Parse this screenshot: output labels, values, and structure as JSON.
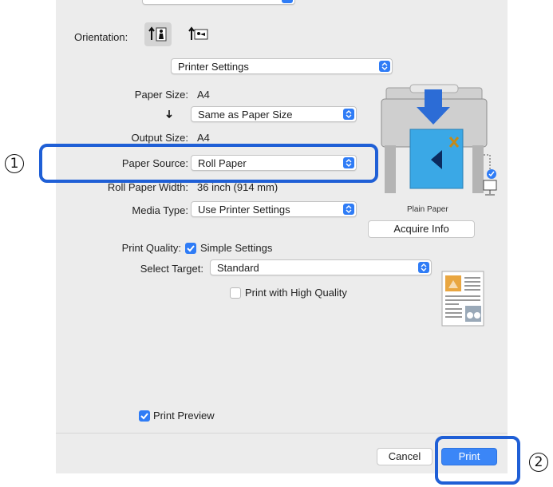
{
  "orientation": {
    "label": "Orientation:",
    "portrait_icon": "portrait-orientation-icon",
    "landscape_icon": "landscape-orientation-icon"
  },
  "panel_select": {
    "value": "Printer Settings"
  },
  "paper_size": {
    "label": "Paper Size:",
    "value": "A4"
  },
  "scale_select": {
    "value": "Same as Paper Size"
  },
  "output_size": {
    "label": "Output Size:",
    "value": "A4"
  },
  "paper_source": {
    "label": "Paper Source:",
    "value": "Roll Paper"
  },
  "roll_width": {
    "label": "Roll Paper Width:",
    "value": "36 inch (914 mm)"
  },
  "media_type": {
    "label": "Media Type:",
    "value": "Use Printer Settings"
  },
  "printer_preview": {
    "caption": "Plain Paper"
  },
  "acquire_info": {
    "label": "Acquire Info"
  },
  "print_quality": {
    "label": "Print Quality:",
    "checkbox_label": "Simple Settings",
    "checked": true
  },
  "select_target": {
    "label": "Select Target:",
    "value": "Standard"
  },
  "high_quality": {
    "label": "Print with High Quality",
    "checked": false
  },
  "print_preview": {
    "label": "Print Preview",
    "checked": true
  },
  "buttons": {
    "cancel": "Cancel",
    "print": "Print"
  },
  "callouts": {
    "one": "1",
    "two": "2"
  },
  "colors": {
    "accent": "#2f7cf6",
    "highlight": "#1f5fd6",
    "dialog_bg": "#ececec"
  }
}
